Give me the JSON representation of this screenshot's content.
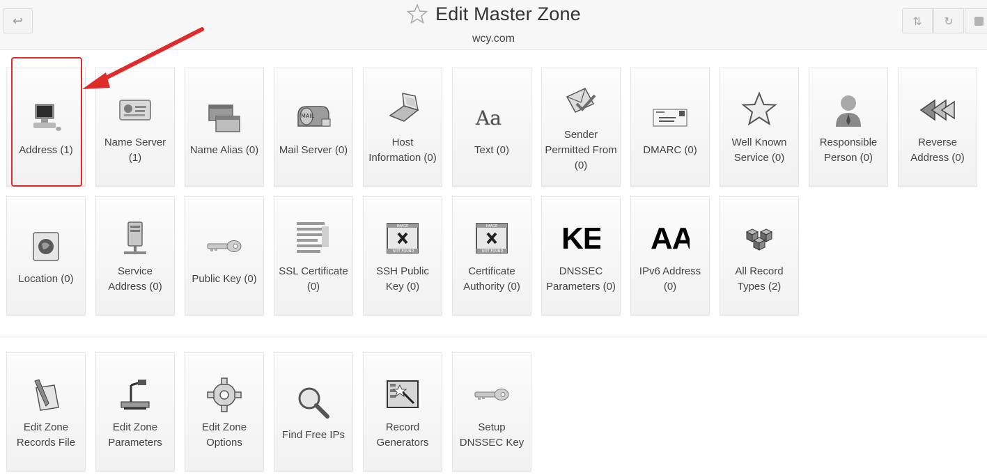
{
  "header": {
    "back_icon": "back-arrow-icon",
    "title": "Edit Master Zone",
    "subtitle": "wcy.com",
    "star_icon": "star-outline-icon",
    "toolbar_icons": [
      "sync-icon",
      "refresh-icon",
      "stop-icon"
    ]
  },
  "record_types": [
    {
      "label": "Address (1)",
      "icon": "computer-icon"
    },
    {
      "label": "Name Server (1)",
      "icon": "id-card-icon"
    },
    {
      "label": "Name Alias (0)",
      "icon": "windows-icon"
    },
    {
      "label": "Mail Server (0)",
      "icon": "mailbox-icon"
    },
    {
      "label": "Host Information (0)",
      "icon": "laptop-icon"
    },
    {
      "label": "Text (0)",
      "icon": "text-aa-icon",
      "icon_text": "Aa"
    },
    {
      "label": "Sender Permitted From (0)",
      "icon": "mail-check-icon"
    },
    {
      "label": "DMARC (0)",
      "icon": "envelope-label-icon"
    },
    {
      "label": "Well Known Service (0)",
      "icon": "star-icon"
    },
    {
      "label": "Responsible Person (0)",
      "icon": "person-icon"
    },
    {
      "label": "Reverse Address (0)",
      "icon": "rewind-icon"
    },
    {
      "label": "Location (0)",
      "icon": "globe-icon"
    },
    {
      "label": "Service Address (0)",
      "icon": "server-icon"
    },
    {
      "label": "Public Key (0)",
      "icon": "key-icon"
    },
    {
      "label": "SSL Certificate (0)",
      "icon": "ssl-text-icon"
    },
    {
      "label": "SSH Public Key (0)",
      "icon": "image-not-found-icon"
    },
    {
      "label": "Certificate Authority (0)",
      "icon": "image-not-found-icon"
    },
    {
      "label": "DNSSEC Parameters (0)",
      "icon": "ke-text-icon",
      "icon_text": "KE"
    },
    {
      "label": "IPv6 Address (0)",
      "icon": "aa-text-icon",
      "icon_text": "AA"
    },
    {
      "label": "All Record Types (2)",
      "icon": "cubes-icon"
    }
  ],
  "zone_actions": [
    {
      "label": "Edit Zone Records File",
      "icon": "pen-paper-icon"
    },
    {
      "label": "Edit Zone Parameters",
      "icon": "projector-icon"
    },
    {
      "label": "Edit Zone Options",
      "icon": "gear-icon"
    },
    {
      "label": "Find Free IPs",
      "icon": "magnifier-icon"
    },
    {
      "label": "Record Generators",
      "icon": "wizard-icon"
    },
    {
      "label": "Setup DNSSEC Key",
      "icon": "key-icon"
    }
  ],
  "image_placeholder_text": {
    "top": "IMAGE",
    "bottom": "NOT FOUND"
  },
  "colors": {
    "highlight": "#e02b2b",
    "arrow": "#e02b2b"
  }
}
